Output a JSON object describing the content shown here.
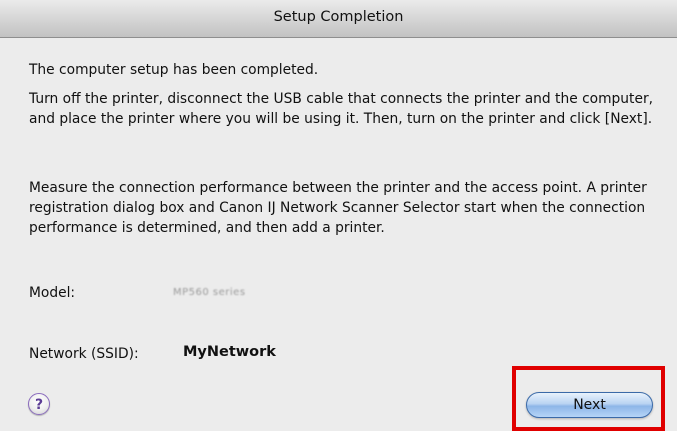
{
  "window": {
    "title": "Setup Completion"
  },
  "body": {
    "paragraph1": "The computer setup has been completed.",
    "paragraph2": "Turn off the printer, disconnect the USB cable that connects the printer and the computer, and place the printer where you will be using it. Then, turn on the printer and click [Next].",
    "paragraph3": "Measure the connection performance between the printer and the access point. A printer registration dialog box and Canon IJ Network Scanner Selector start when the connection performance is determined, and then add a printer."
  },
  "fields": {
    "model_label": "Model:",
    "model_value": "MP560 series",
    "network_label": "Network (SSID):",
    "network_value": "MyNetwork"
  },
  "buttons": {
    "help_label": "?",
    "next_label": "Next"
  },
  "colors": {
    "highlight_border": "#e00000",
    "next_button_blue": "#8db6e8",
    "help_icon_purple": "#5b3c95"
  }
}
